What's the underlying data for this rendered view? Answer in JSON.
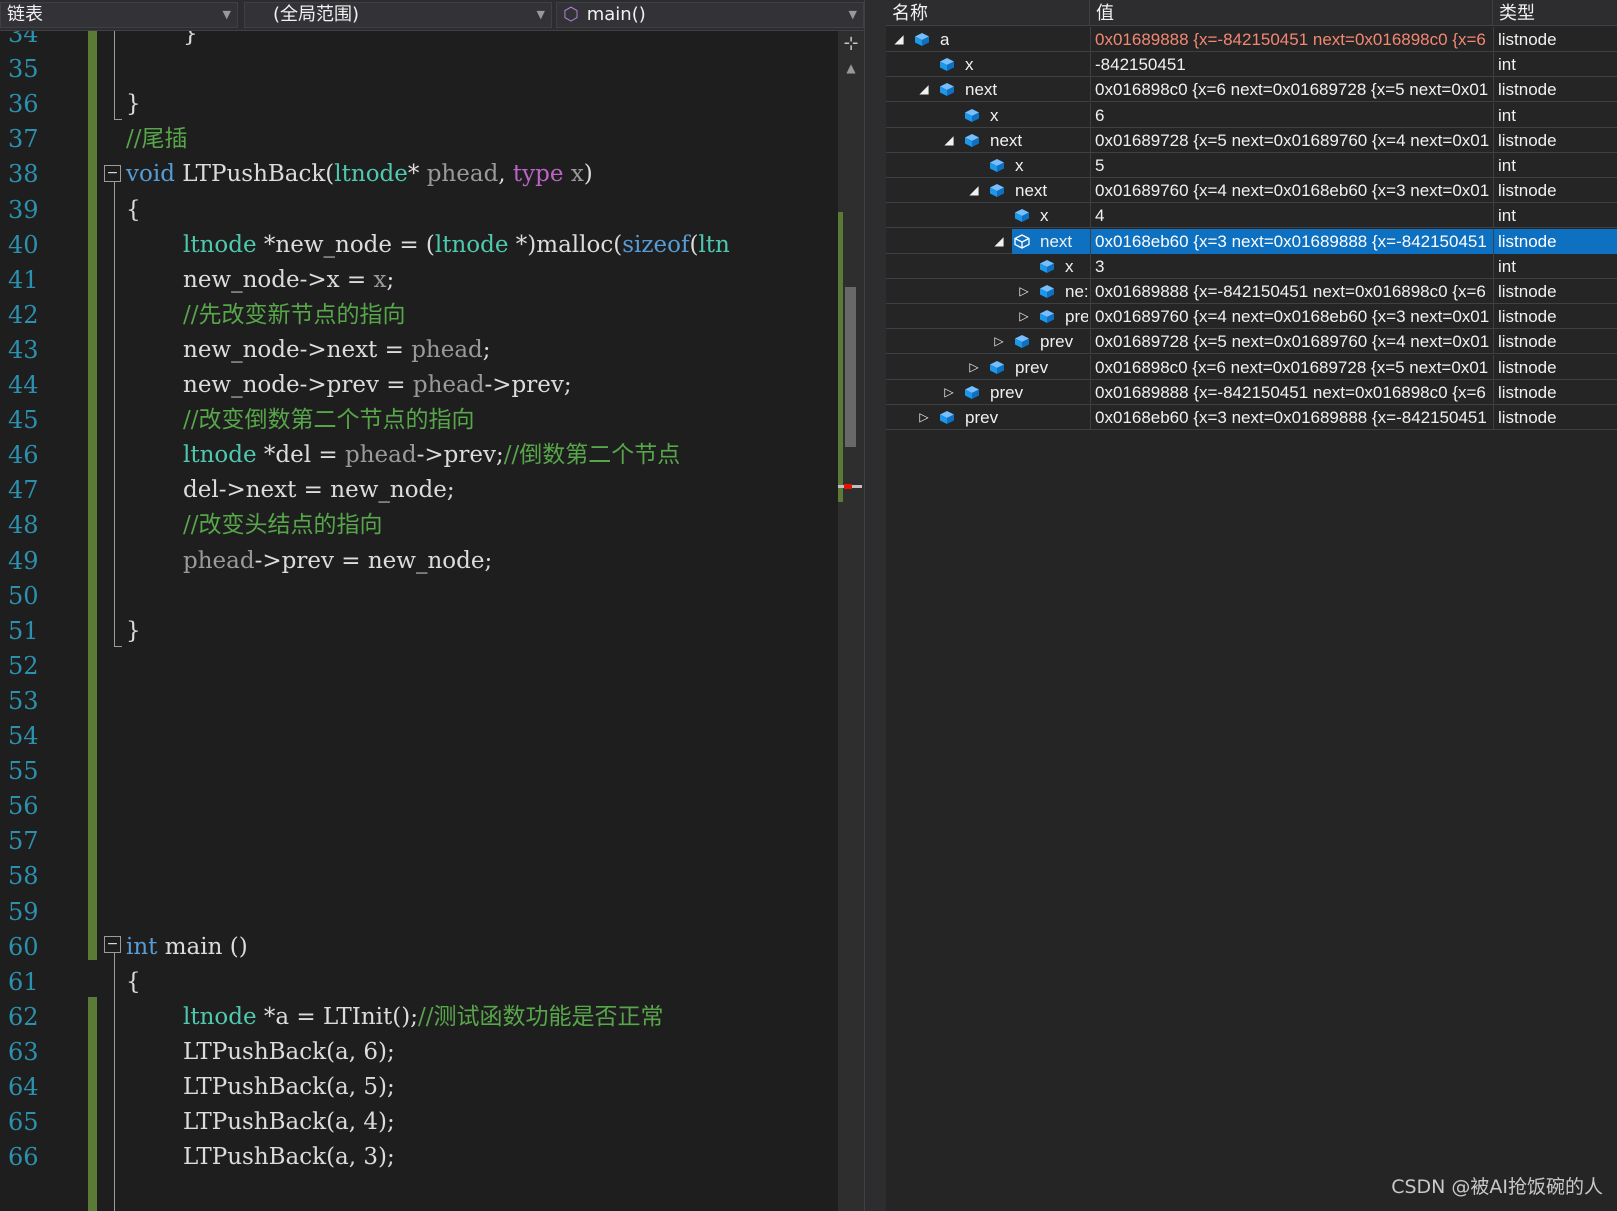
{
  "editor": {
    "nav": {
      "project": "链表",
      "scope": "(全局范围)",
      "member": "main()"
    },
    "lines": [
      {
        "num": "34",
        "code": [
          {
            "t": "}",
            "c": "pl"
          }
        ],
        "indent": 2
      },
      {
        "num": "35",
        "code": [],
        "indent": 0
      },
      {
        "num": "36",
        "code": [
          {
            "t": "}",
            "c": "pl"
          }
        ],
        "indent": 0
      },
      {
        "num": "37",
        "code": [
          {
            "t": "//尾插",
            "c": "cm"
          }
        ],
        "indent": 0
      },
      {
        "num": "38",
        "code": [
          {
            "t": "void",
            "c": "kw"
          },
          {
            "t": " LTPushBack(",
            "c": "pl"
          },
          {
            "t": "ltnode",
            "c": "ty"
          },
          {
            "t": "* ",
            "c": "pl"
          },
          {
            "t": "phead",
            "c": "pm"
          },
          {
            "t": ", ",
            "c": "pl"
          },
          {
            "t": "type",
            "c": "mc"
          },
          {
            "t": " ",
            "c": "pl"
          },
          {
            "t": "x",
            "c": "pm"
          },
          {
            "t": ")",
            "c": "pl"
          }
        ],
        "indent": 0
      },
      {
        "num": "39",
        "code": [
          {
            "t": "{",
            "c": "pl"
          }
        ],
        "indent": 0
      },
      {
        "num": "40",
        "code": [
          {
            "t": "ltnode",
            "c": "ty"
          },
          {
            "t": " *new_node = (",
            "c": "pl"
          },
          {
            "t": "ltnode",
            "c": "ty"
          },
          {
            "t": " *)malloc(",
            "c": "pl"
          },
          {
            "t": "sizeof",
            "c": "kw"
          },
          {
            "t": "(",
            "c": "pl"
          },
          {
            "t": "ltn",
            "c": "ty"
          }
        ],
        "indent": 2
      },
      {
        "num": "41",
        "code": [
          {
            "t": "new_node->x = ",
            "c": "pl"
          },
          {
            "t": "x",
            "c": "pm"
          },
          {
            "t": ";",
            "c": "pl"
          }
        ],
        "indent": 2
      },
      {
        "num": "42",
        "code": [
          {
            "t": "//先改变新节点的指向",
            "c": "cm"
          }
        ],
        "indent": 2
      },
      {
        "num": "43",
        "code": [
          {
            "t": "new_node->next = ",
            "c": "pl"
          },
          {
            "t": "phead",
            "c": "pm"
          },
          {
            "t": ";",
            "c": "pl"
          }
        ],
        "indent": 2
      },
      {
        "num": "44",
        "code": [
          {
            "t": "new_node->prev = ",
            "c": "pl"
          },
          {
            "t": "phead",
            "c": "pm"
          },
          {
            "t": "->prev;",
            "c": "pl"
          }
        ],
        "indent": 2
      },
      {
        "num": "45",
        "code": [
          {
            "t": "//改变倒数第二个节点的指向",
            "c": "cm"
          }
        ],
        "indent": 2
      },
      {
        "num": "46",
        "code": [
          {
            "t": "ltnode",
            "c": "ty"
          },
          {
            "t": " *del = ",
            "c": "pl"
          },
          {
            "t": "phead",
            "c": "pm"
          },
          {
            "t": "->prev;",
            "c": "pl"
          },
          {
            "t": "//倒数第二个节点",
            "c": "cm"
          }
        ],
        "indent": 2
      },
      {
        "num": "47",
        "code": [
          {
            "t": "del->next = new_node;",
            "c": "pl"
          }
        ],
        "indent": 2
      },
      {
        "num": "48",
        "code": [
          {
            "t": "//改变头结点的指向",
            "c": "cm"
          }
        ],
        "indent": 2
      },
      {
        "num": "49",
        "code": [
          {
            "t": "phead",
            "c": "pm"
          },
          {
            "t": "->prev = new_node;",
            "c": "pl"
          }
        ],
        "indent": 2
      },
      {
        "num": "50",
        "code": [],
        "indent": 0
      },
      {
        "num": "51",
        "code": [
          {
            "t": "}",
            "c": "pl"
          }
        ],
        "indent": 0
      },
      {
        "num": "52",
        "code": [],
        "indent": 0
      },
      {
        "num": "53",
        "code": [],
        "indent": 0
      },
      {
        "num": "54",
        "code": [],
        "indent": 0
      },
      {
        "num": "55",
        "code": [],
        "indent": 0
      },
      {
        "num": "56",
        "code": [],
        "indent": 0
      },
      {
        "num": "57",
        "code": [],
        "indent": 0
      },
      {
        "num": "58",
        "code": [],
        "indent": 0
      },
      {
        "num": "59",
        "code": [],
        "indent": 0
      },
      {
        "num": "60",
        "code": [
          {
            "t": "int",
            "c": "kw"
          },
          {
            "t": " main ()",
            "c": "pl"
          }
        ],
        "indent": 0
      },
      {
        "num": "61",
        "code": [
          {
            "t": "{",
            "c": "pl"
          }
        ],
        "indent": 0
      },
      {
        "num": "62",
        "code": [
          {
            "t": "ltnode",
            "c": "ty"
          },
          {
            "t": " *a = LTInit();",
            "c": "pl"
          },
          {
            "t": "//测试函数功能是否正常",
            "c": "cm"
          }
        ],
        "indent": 2
      },
      {
        "num": "63",
        "code": [
          {
            "t": "LTPushBack(a, 6);",
            "c": "pl"
          }
        ],
        "indent": 2
      },
      {
        "num": "64",
        "code": [
          {
            "t": "LTPushBack(a, 5);",
            "c": "pl"
          }
        ],
        "indent": 2
      },
      {
        "num": "65",
        "code": [
          {
            "t": "LTPushBack(a, 4);",
            "c": "pl"
          }
        ],
        "indent": 2
      },
      {
        "num": "66",
        "code": [
          {
            "t": "LTPushBack(a, 3);",
            "c": "pl"
          }
        ],
        "indent": 2
      }
    ]
  },
  "watch": {
    "headers": {
      "name": "名称",
      "value": "值",
      "type": "类型"
    },
    "rows": [
      {
        "depth": 0,
        "expander": "open",
        "name": "a",
        "value": "0x01689888 {x=-842150451 next=0x016898c0 {x=6",
        "type": "listnode",
        "changed": true
      },
      {
        "depth": 1,
        "expander": "none",
        "name": "x",
        "value": "-842150451",
        "type": "int"
      },
      {
        "depth": 1,
        "expander": "open",
        "name": "next",
        "value": "0x016898c0 {x=6 next=0x01689728 {x=5 next=0x01",
        "type": "listnode"
      },
      {
        "depth": 2,
        "expander": "none",
        "name": "x",
        "value": "6",
        "type": "int"
      },
      {
        "depth": 2,
        "expander": "open",
        "name": "next",
        "value": "0x01689728 {x=5 next=0x01689760 {x=4 next=0x01",
        "type": "listnode"
      },
      {
        "depth": 3,
        "expander": "none",
        "name": "x",
        "value": "5",
        "type": "int"
      },
      {
        "depth": 3,
        "expander": "open",
        "name": "next",
        "value": "0x01689760 {x=4 next=0x0168eb60 {x=3 next=0x01",
        "type": "listnode"
      },
      {
        "depth": 4,
        "expander": "none",
        "name": "x",
        "value": "4",
        "type": "int"
      },
      {
        "depth": 4,
        "expander": "open",
        "name": "next",
        "value": "0x0168eb60 {x=3 next=0x01689888 {x=-842150451",
        "type": "listnode",
        "selected": true
      },
      {
        "depth": 5,
        "expander": "none",
        "name": "x",
        "value": "3",
        "type": "int"
      },
      {
        "depth": 5,
        "expander": "closed",
        "name": "ne:",
        "value": "0x01689888 {x=-842150451 next=0x016898c0 {x=6",
        "type": "listnode"
      },
      {
        "depth": 5,
        "expander": "closed",
        "name": "pre",
        "value": "0x01689760 {x=4 next=0x0168eb60 {x=3 next=0x01",
        "type": "listnode"
      },
      {
        "depth": 4,
        "expander": "closed",
        "name": "prev",
        "value": "0x01689728 {x=5 next=0x01689760 {x=4 next=0x01",
        "type": "listnode"
      },
      {
        "depth": 3,
        "expander": "closed",
        "name": "prev",
        "value": "0x016898c0 {x=6 next=0x01689728 {x=5 next=0x01",
        "type": "listnode"
      },
      {
        "depth": 2,
        "expander": "closed",
        "name": "prev",
        "value": "0x01689888 {x=-842150451 next=0x016898c0 {x=6",
        "type": "listnode"
      },
      {
        "depth": 1,
        "expander": "closed",
        "name": "prev",
        "value": "0x0168eb60 {x=3 next=0x01689888 {x=-842150451",
        "type": "listnode"
      }
    ]
  },
  "watermark": "CSDN @被AI抢饭碗的人",
  "colors": {
    "keyword": "#569cd6",
    "type": "#4ec9b0",
    "comment": "#57a64a",
    "param": "#9a9a9a",
    "macro": "#bd63c5",
    "line_number": "#2b91af",
    "change_bar": "#5b7a35",
    "selection": "#0e70c0",
    "changed_value": "#f48771"
  }
}
